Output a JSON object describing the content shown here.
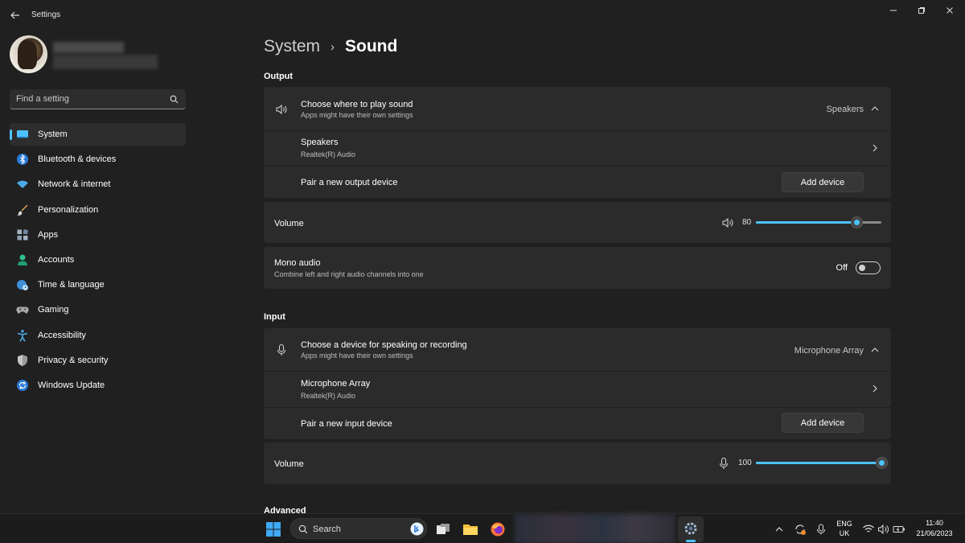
{
  "window": {
    "title": "Settings"
  },
  "search": {
    "placeholder": "Find a setting"
  },
  "nav": {
    "items": [
      {
        "label": "System",
        "icon": "monitor-icon",
        "active": true
      },
      {
        "label": "Bluetooth & devices",
        "icon": "bluetooth-icon"
      },
      {
        "label": "Network & internet",
        "icon": "wifi-icon"
      },
      {
        "label": "Personalization",
        "icon": "brush-icon"
      },
      {
        "label": "Apps",
        "icon": "apps-icon"
      },
      {
        "label": "Accounts",
        "icon": "person-icon"
      },
      {
        "label": "Time & language",
        "icon": "globe-clock-icon"
      },
      {
        "label": "Gaming",
        "icon": "gamepad-icon"
      },
      {
        "label": "Accessibility",
        "icon": "accessibility-icon"
      },
      {
        "label": "Privacy & security",
        "icon": "shield-icon"
      },
      {
        "label": "Windows Update",
        "icon": "update-icon"
      }
    ]
  },
  "breadcrumb": {
    "parent": "System",
    "separator": "›",
    "current": "Sound"
  },
  "output": {
    "section_title": "Output",
    "choose": {
      "title": "Choose where to play sound",
      "subtitle": "Apps might have their own settings",
      "value": "Speakers"
    },
    "device": {
      "name": "Speakers",
      "driver": "Realtek(R) Audio"
    },
    "pair": {
      "label": "Pair a new output device",
      "button": "Add device"
    },
    "volume": {
      "label": "Volume",
      "value": "80",
      "level": 80
    },
    "mono": {
      "title": "Mono audio",
      "subtitle": "Combine left and right audio channels into one",
      "state": "Off"
    }
  },
  "input": {
    "section_title": "Input",
    "choose": {
      "title": "Choose a device for speaking or recording",
      "subtitle": "Apps might have their own settings",
      "value": "Microphone Array"
    },
    "device": {
      "name": "Microphone Array",
      "driver": "Realtek(R) Audio"
    },
    "pair": {
      "label": "Pair a new input device",
      "button": "Add device"
    },
    "volume": {
      "label": "Volume",
      "value": "100",
      "level": 100
    }
  },
  "advanced": {
    "section_title": "Advanced"
  },
  "taskbar": {
    "search_label": "Search",
    "lang_line1": "ENG",
    "lang_line2": "UK",
    "time": "11:40",
    "date": "21/06/2023"
  },
  "colors": {
    "accent": "#4cc2ff",
    "background": "#202020",
    "card": "#2b2b2b"
  }
}
